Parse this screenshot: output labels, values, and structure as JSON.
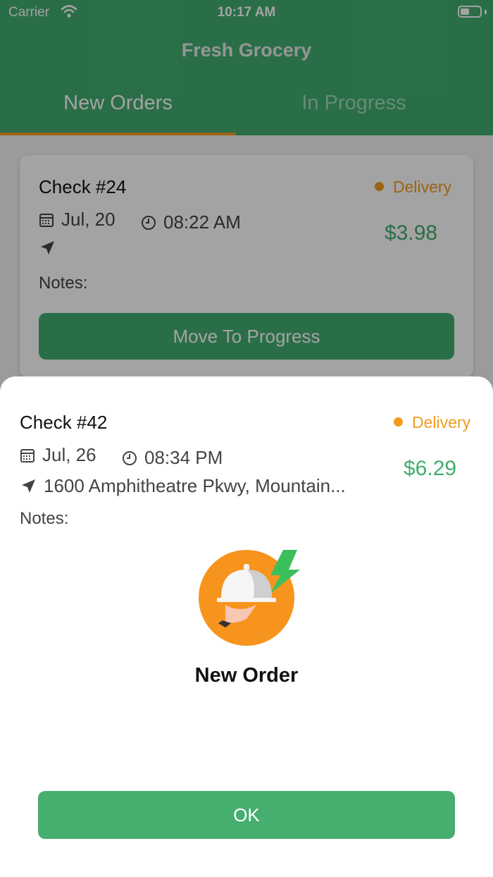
{
  "status_bar": {
    "carrier": "Carrier",
    "time": "10:17 AM"
  },
  "header": {
    "title": "Fresh Grocery"
  },
  "tabs": [
    {
      "label": "New Orders",
      "active": true
    },
    {
      "label": "In Progress",
      "active": false
    }
  ],
  "orders": [
    {
      "check": "Check #24",
      "type": "Delivery",
      "date": "Jul, 20",
      "time": "08:22 AM",
      "address": "",
      "price": "$3.98",
      "notes": "Notes:",
      "action": "Move To Progress"
    }
  ],
  "new_order_sheet": {
    "check": "Check #42",
    "type": "Delivery",
    "date": "Jul, 26",
    "time": "08:34 PM",
    "address": "1600 Amphitheatre Pkwy, Mountain...",
    "price": "$6.29",
    "notes": "Notes:",
    "title": "New Order",
    "ok_label": "OK"
  },
  "colors": {
    "primary": "#43ad6f",
    "accent": "#f29b20",
    "text": "#111111",
    "muted": "#444444"
  },
  "icons": [
    "wifi-icon",
    "battery-icon",
    "calendar-icon",
    "clock-icon",
    "location-arrow-icon",
    "order-illustration-icon"
  ]
}
